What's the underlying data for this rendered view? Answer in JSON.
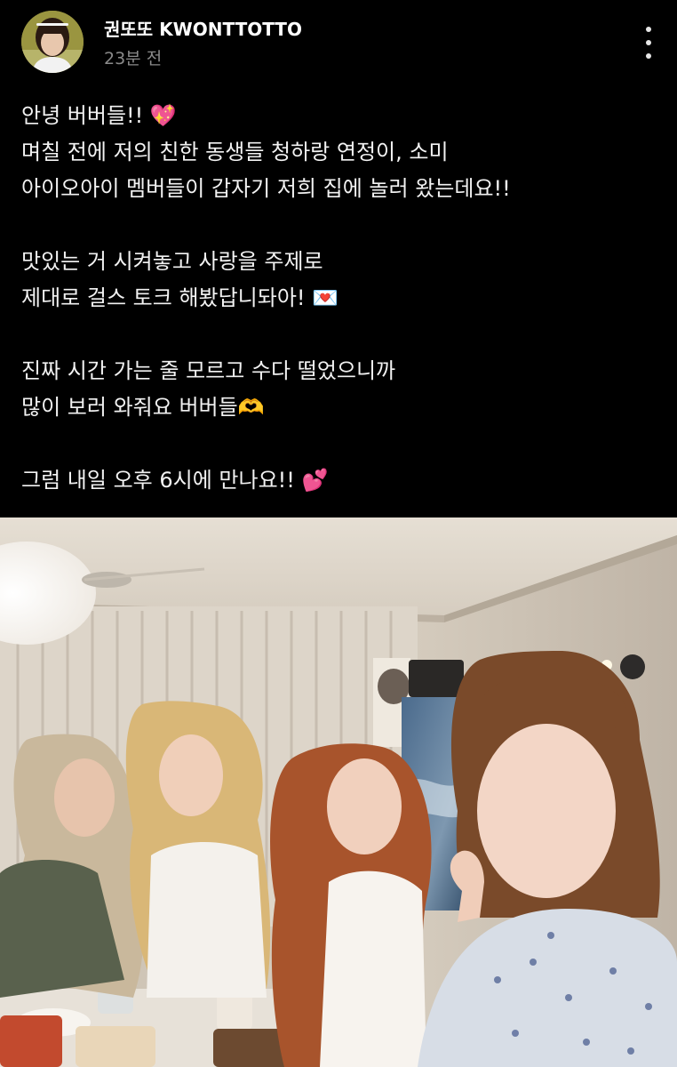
{
  "post": {
    "author": {
      "name": "권또또 KWONTTOTTO",
      "avatar": "avatar"
    },
    "time": "23분 전",
    "more_icon": "more-vertical-icon",
    "text_lines": [
      "안녕 버버들!! 💖",
      "며칠 전에 저의 친한 동생들 청하랑 연정이, 소미",
      "아이오아이 멤버들이 갑자기 저희 집에 놀러 왔는데요!!",
      "",
      "맛있는 거 시켜놓고 사랑을 주제로",
      "제대로 걸스 토크 해봤답니돠아! 💌",
      "",
      "진짜 시간 가는 줄 모르고 수다 떨었으니까",
      "많이 보러 와줘요 버버들🫶",
      "",
      "그럼 내일 오후 6시에 만나요!! 💕"
    ],
    "photo": "group-selfie-photo"
  }
}
